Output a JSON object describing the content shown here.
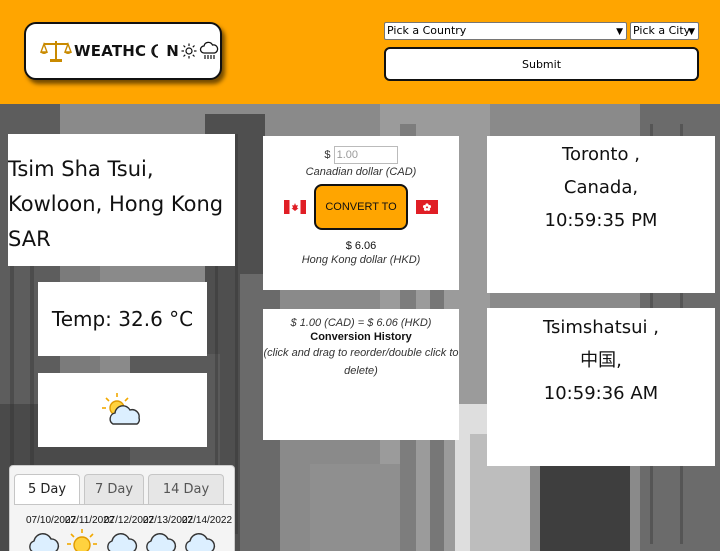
{
  "header": {
    "logo_text_a": "WEATHC",
    "logo_text_b": "N",
    "country_select": "Pick a Country",
    "city_select": "Pick a City",
    "submit_label": "Submit",
    "accent_color": "#ffa500"
  },
  "location": {
    "line1": "Tsim Sha Tsui,",
    "line2": "Kowloon, Hong Kong",
    "line3": "SAR"
  },
  "temperature": {
    "label": "Temp: 32.6 °C",
    "icon": "partly-cloudy-icon"
  },
  "converter": {
    "currency_symbol": "$",
    "amount_placeholder": "1.00",
    "from_currency": "Canadian dollar (CAD)",
    "convert_label": "CONVERT TO",
    "result_value": "$ 6.06",
    "to_currency": "Hong Kong dollar (HKD)",
    "from_flag": "canada-flag-icon",
    "to_flag": "hong-kong-flag-icon"
  },
  "history": {
    "item": "$ 1.00 (CAD) = $ 6.06 (HKD)",
    "title": "Conversion History",
    "note": "(click and drag to reorder/double click to delete)"
  },
  "timezones": [
    {
      "city": "Toronto ,",
      "country": "Canada,",
      "time": "10:59:35 PM"
    },
    {
      "city": "Tsimshatsui ,",
      "country": "中国,",
      "time": "10:59:36 AM"
    }
  ],
  "forecast": {
    "tabs": [
      "5 Day",
      "7 Day",
      "14 Day"
    ],
    "active_tab": "5 Day",
    "days": [
      {
        "date": "07/10/2022",
        "icon": "cloud-icon"
      },
      {
        "date": "07/11/2022",
        "icon": "sun-icon"
      },
      {
        "date": "07/12/2022",
        "icon": "cloud-icon"
      },
      {
        "date": "07/13/2022",
        "icon": "cloud-icon"
      },
      {
        "date": "07/14/2022",
        "icon": "cloud-icon"
      }
    ]
  }
}
